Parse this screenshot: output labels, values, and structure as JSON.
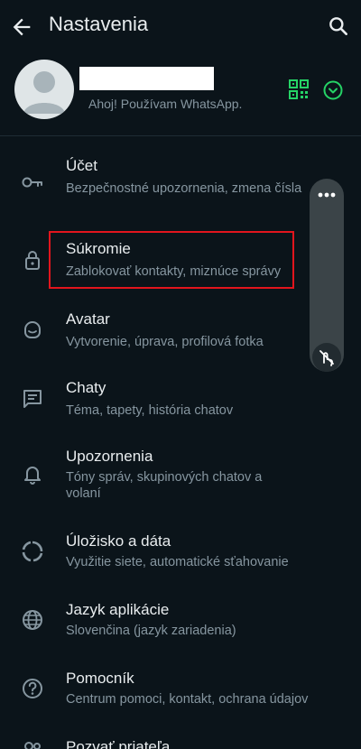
{
  "header": {
    "title": "Nastavenia",
    "back_icon": "arrow-left-icon",
    "search_icon": "search-icon"
  },
  "profile": {
    "status": "Ahoj! Používam WhatsApp.",
    "qr_icon": "qr-code-icon",
    "expand_icon": "chevron-down-circle-icon",
    "accent_color": "#25d366"
  },
  "settings": {
    "items": [
      {
        "icon": "key-icon",
        "title": "Účet",
        "subtitle": "Bezpečnostné upozornenia, zmena čísla"
      },
      {
        "icon": "lock-icon",
        "title": "Súkromie",
        "subtitle": "Zablokovať kontakty, miznúce správy"
      },
      {
        "icon": "avatar-face-icon",
        "title": "Avatar",
        "subtitle": "Vytvorenie, úprava, profilová fotka"
      },
      {
        "icon": "chat-icon",
        "title": "Chaty",
        "subtitle": "Téma, tapety, história chatov"
      },
      {
        "icon": "bell-icon",
        "title": "Upozornenia",
        "subtitle": "Tóny správ, skupinových chatov a volaní"
      },
      {
        "icon": "storage-circle-icon",
        "title": "Úložisko a dáta",
        "subtitle": "Využitie siete, automatické sťahovanie"
      },
      {
        "icon": "globe-icon",
        "title": "Jazyk aplikácie",
        "subtitle": "Slovenčina (jazyk zariadenia)"
      },
      {
        "icon": "help-icon",
        "title": "Pomocník",
        "subtitle": "Centrum pomoci, kontakt, ochrana údajov"
      },
      {
        "icon": "invite-people-icon",
        "title": "Pozvať priateľa",
        "subtitle": ""
      }
    ]
  },
  "side_panel": {
    "more_icon": "more-dots-icon",
    "mic_off_icon": "touch-off-icon"
  },
  "colors": {
    "background": "#0b141a",
    "highlight": "#e2151d"
  }
}
